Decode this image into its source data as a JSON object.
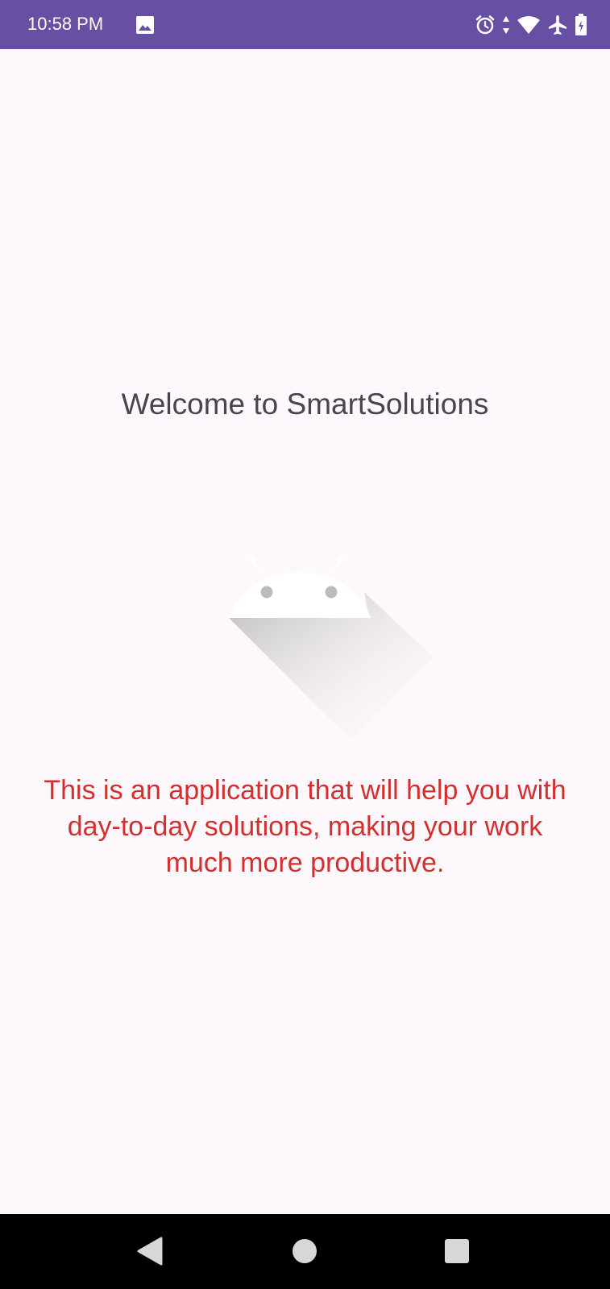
{
  "status_bar": {
    "time": "10:58 PM",
    "background_color": "#6750a4",
    "icons": [
      "gallery-icon",
      "alarm-icon",
      "data-arrows-icon",
      "wifi-icon",
      "airplane-icon",
      "battery-icon"
    ]
  },
  "main": {
    "welcome_text": "Welcome to SmartSolutions",
    "description": "This is an application that will help you with day-to-day solutions, making your work much more productive.",
    "description_color": "#d32f2f",
    "image": "android-logo-icon"
  },
  "nav_bar": {
    "buttons": [
      "back-icon",
      "home-icon",
      "recents-icon"
    ]
  }
}
